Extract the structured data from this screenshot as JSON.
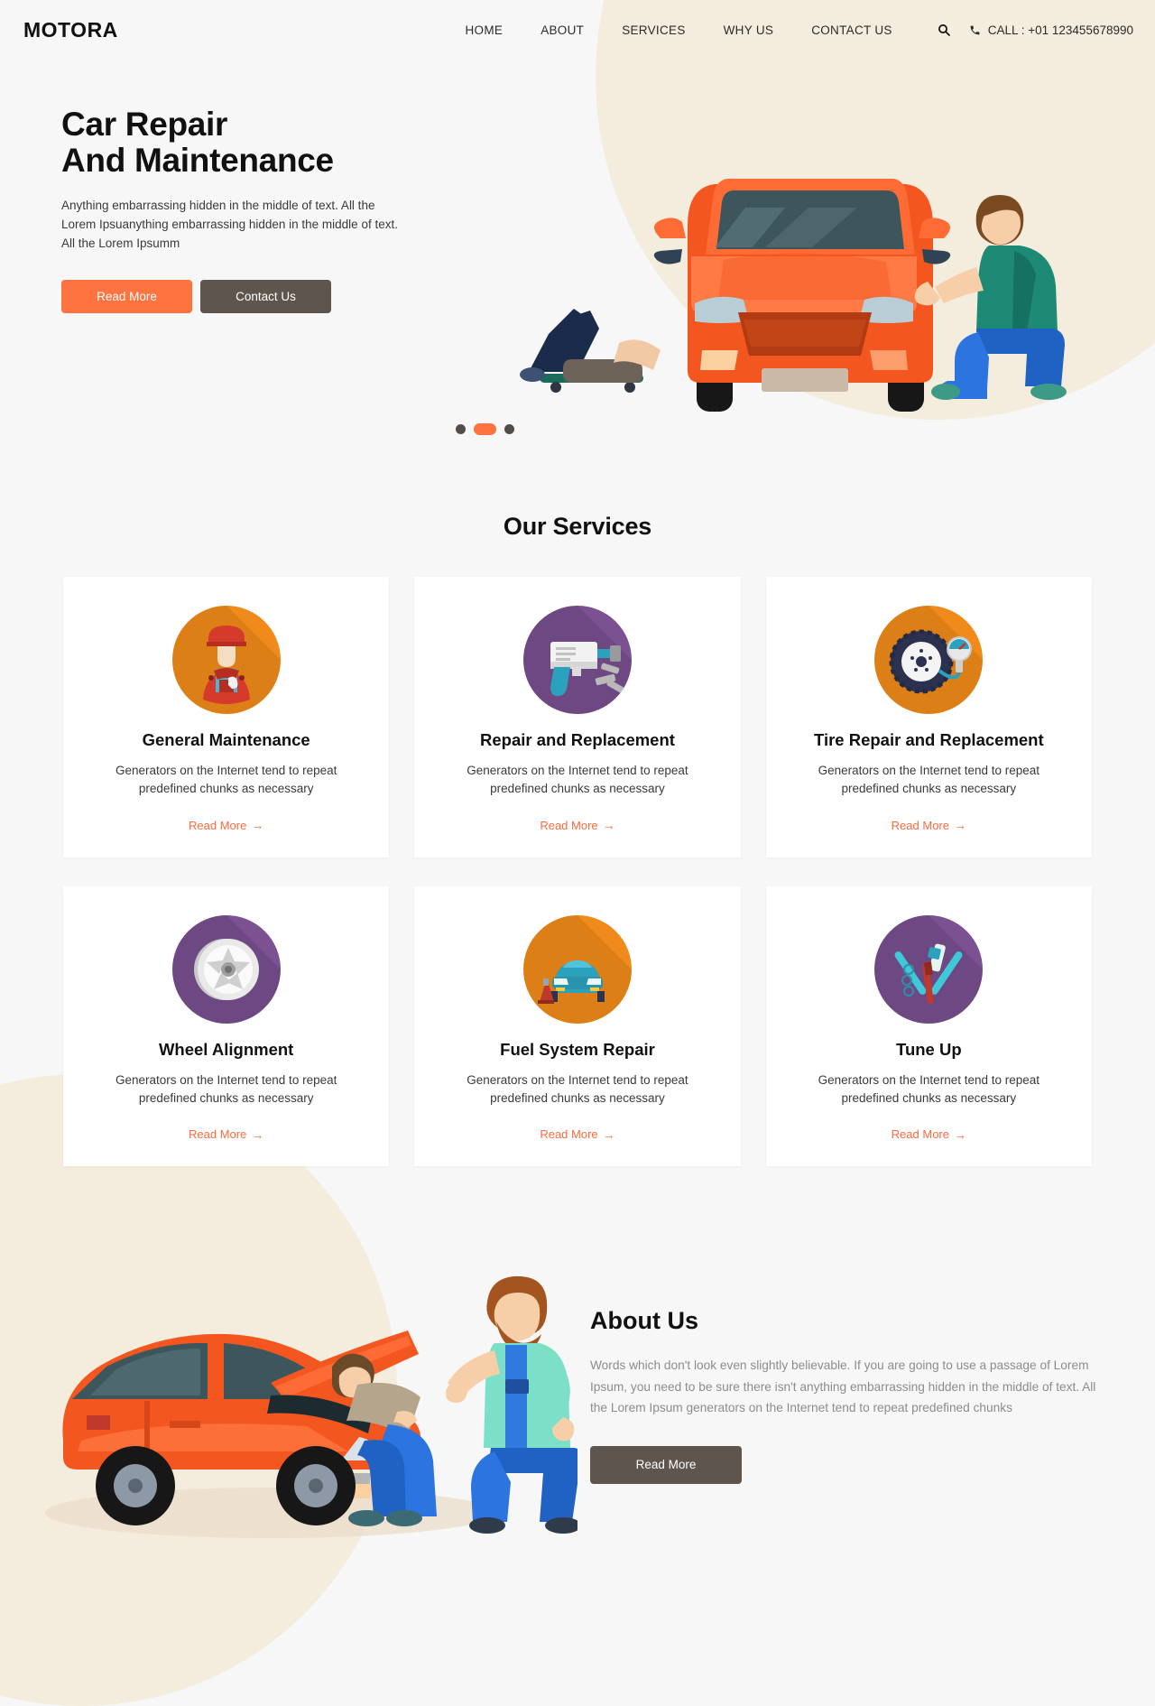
{
  "brand": {
    "logo": "MOTORA"
  },
  "header": {
    "nav": [
      {
        "label": "HOME",
        "name": "nav-home"
      },
      {
        "label": "ABOUT",
        "name": "nav-about"
      },
      {
        "label": "SERVICES",
        "name": "nav-services"
      },
      {
        "label": "WHY US",
        "name": "nav-why-us"
      },
      {
        "label": "CONTACT US",
        "name": "nav-contact-us"
      }
    ],
    "search_icon": "search-icon",
    "phone_icon": "phone-icon",
    "call_text": "CALL : +01 123455678990"
  },
  "hero": {
    "title_line1": "Car Repair",
    "title_line2": "And Maintenance",
    "paragraph": "Anything embarrassing hidden in the middle of text. All the Lorem Ipsuanything embarrassing hidden in the middle of text. All the Lorem Ipsumm",
    "primary_button": "Read More",
    "secondary_button": "Contact Us",
    "carousel": {
      "slides": 3,
      "active_index": 1
    }
  },
  "services": {
    "title": "Our Services",
    "read_more": "Read More",
    "arrow": "→",
    "cards": [
      {
        "title": "General Maintenance",
        "text": "Generators on the Internet tend to repeat predefined chunks as necessary",
        "icon": "mechanic-icon",
        "bg": "#f08a1a"
      },
      {
        "title": "Repair and Replacement",
        "text": "Generators on the Internet tend to repeat predefined chunks as necessary",
        "icon": "impact-wrench-icon",
        "bg": "#7b5192"
      },
      {
        "title": "Tire Repair and Replacement",
        "text": "Generators on the Internet tend to repeat predefined chunks as necessary",
        "icon": "tire-gauge-icon",
        "bg": "#f08a1a"
      },
      {
        "title": "Wheel Alignment",
        "text": "Generators on the Internet tend to repeat predefined chunks as necessary",
        "icon": "wheel-rim-icon",
        "bg": "#7b5192"
      },
      {
        "title": "Fuel System Repair",
        "text": "Generators on the Internet tend to repeat predefined chunks as necessary",
        "icon": "car-on-jack-icon",
        "bg": "#f08a1a"
      },
      {
        "title": "Tune Up",
        "text": "Generators on the Internet tend to repeat predefined chunks as necessary",
        "icon": "crossed-tools-icon",
        "bg": "#7b5192"
      }
    ]
  },
  "about": {
    "title": "About Us",
    "paragraph": "Words which don't look even slightly believable. If you are going to use a passage of Lorem Ipsum, you need to be sure there isn't anything embarrassing hidden in the middle of text. All the Lorem Ipsum generators on the Internet tend to repeat predefined chunks",
    "button": "Read More",
    "illustration": "mechanics-fixing-car-illustration"
  },
  "colors": {
    "accent": "#ff7340",
    "accent_link": "#ff6a3d",
    "dark_button": "#5f554f",
    "page_bg": "#f7f7f7",
    "blob": "#f4ecdc",
    "card_bg": "#ffffff"
  }
}
